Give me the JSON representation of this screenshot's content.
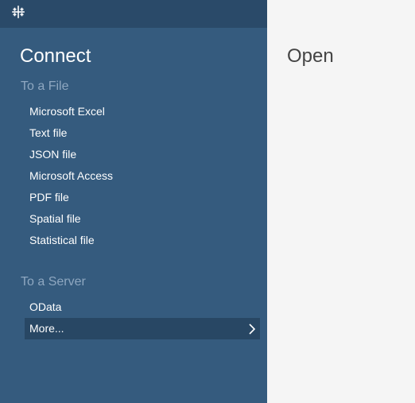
{
  "connect": {
    "title": "Connect",
    "to_file": {
      "heading": "To a File",
      "items": [
        "Microsoft Excel",
        "Text file",
        "JSON file",
        "Microsoft Access",
        "PDF file",
        "Spatial file",
        "Statistical file"
      ]
    },
    "to_server": {
      "heading": "To a Server",
      "items": [
        "OData",
        "More..."
      ]
    }
  },
  "open": {
    "title": "Open"
  },
  "icons": {
    "logo": "tableau-logo-icon",
    "more_chevron": "chevron-right-icon"
  },
  "colors": {
    "sidebar_bg": "#355b7e",
    "topbar_bg": "#2a4a69",
    "highlight_bg": "#284764",
    "heading_text": "#8ea7c0",
    "main_bg": "#f5f5f5"
  }
}
